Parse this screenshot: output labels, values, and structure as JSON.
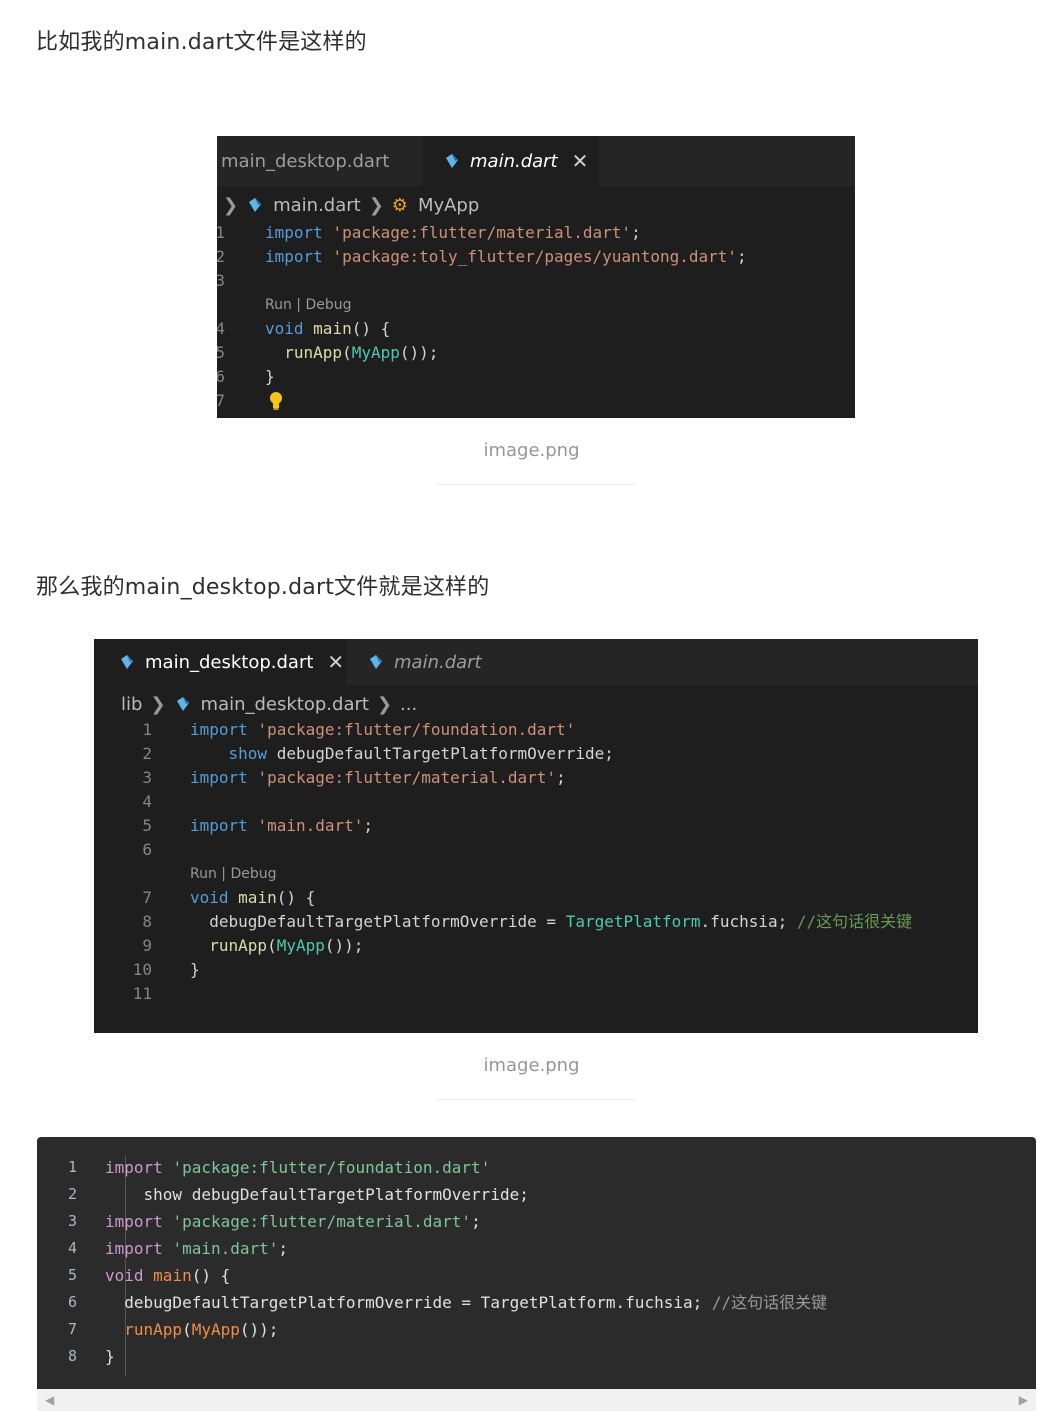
{
  "intro1": "比如我的main.dart文件是这样的",
  "intro2": "那么我的main_desktop.dart文件就是这样的",
  "caption": "image.png",
  "shot1": {
    "tab_inactive": "main_desktop.dart",
    "tab_active": "main.dart",
    "crumb_file": "main.dart",
    "crumb_class": "MyApp",
    "lines": [
      {
        "n": "1",
        "segments": [
          [
            "kw",
            "import"
          ],
          [
            "plain",
            " "
          ],
          [
            "str",
            "'package:flutter/material.dart'"
          ],
          [
            "plain",
            ";"
          ]
        ]
      },
      {
        "n": "2",
        "segments": [
          [
            "kw",
            "import"
          ],
          [
            "plain",
            " "
          ],
          [
            "str",
            "'package:toly_flutter/pages/yuantong.dart'"
          ],
          [
            "plain",
            ";"
          ]
        ]
      },
      {
        "n": "3",
        "segments": []
      },
      {
        "lens": "Run | Debug"
      },
      {
        "n": "4",
        "segments": [
          [
            "kw",
            "void"
          ],
          [
            "plain",
            " "
          ],
          [
            "fn",
            "main"
          ],
          [
            "plain",
            "() {"
          ]
        ]
      },
      {
        "n": "5",
        "segments": [
          [
            "plain",
            "  "
          ],
          [
            "fn",
            "runApp"
          ],
          [
            "plain",
            "("
          ],
          [
            "cls",
            "MyApp"
          ],
          [
            "plain",
            "());"
          ]
        ]
      },
      {
        "n": "6",
        "segments": [
          [
            "plain",
            "}"
          ]
        ]
      },
      {
        "n": "7",
        "segments": []
      }
    ]
  },
  "shot2": {
    "tab_active": "main_desktop.dart",
    "tab_inactive": "main.dart",
    "crumb_lib": "lib",
    "crumb_file": "main_desktop.dart",
    "crumb_more": "...",
    "lines": [
      {
        "n": "1",
        "segments": [
          [
            "kw",
            "import"
          ],
          [
            "plain",
            " "
          ],
          [
            "str",
            "'package:flutter/foundation.dart'"
          ]
        ]
      },
      {
        "n": "2",
        "segments": [
          [
            "plain",
            "    "
          ],
          [
            "kw",
            "show"
          ],
          [
            "plain",
            " debugDefaultTargetPlatformOverride;"
          ]
        ]
      },
      {
        "n": "3",
        "segments": [
          [
            "kw",
            "import"
          ],
          [
            "plain",
            " "
          ],
          [
            "str",
            "'package:flutter/material.dart'"
          ],
          [
            "plain",
            ";"
          ]
        ]
      },
      {
        "n": "4",
        "segments": []
      },
      {
        "n": "5",
        "segments": [
          [
            "kw",
            "import"
          ],
          [
            "plain",
            " "
          ],
          [
            "str",
            "'main.dart'"
          ],
          [
            "plain",
            ";"
          ]
        ]
      },
      {
        "n": "6",
        "segments": []
      },
      {
        "lens": "Run | Debug"
      },
      {
        "n": "7",
        "segments": [
          [
            "kw",
            "void"
          ],
          [
            "plain",
            " "
          ],
          [
            "fn",
            "main"
          ],
          [
            "plain",
            "() {"
          ]
        ]
      },
      {
        "n": "8",
        "segments": [
          [
            "plain",
            "  debugDefaultTargetPlatformOverride = "
          ],
          [
            "cls",
            "TargetPlatform"
          ],
          [
            "plain",
            ".fuchsia; "
          ],
          [
            "cmt",
            "//这句话很关键"
          ]
        ]
      },
      {
        "n": "9",
        "segments": [
          [
            "plain",
            "  "
          ],
          [
            "fn",
            "runApp"
          ],
          [
            "plain",
            "("
          ],
          [
            "cls",
            "MyApp"
          ],
          [
            "plain",
            "());"
          ]
        ]
      },
      {
        "n": "10",
        "segments": [
          [
            "plain",
            "}"
          ]
        ]
      },
      {
        "n": "11",
        "segments": []
      }
    ]
  },
  "codeblock": {
    "lines": [
      {
        "n": "1",
        "segments": [
          [
            "hkw2",
            "import"
          ],
          [
            "hplain",
            " "
          ],
          [
            "hstr",
            "'package:flutter/foundation.dart'"
          ]
        ]
      },
      {
        "n": "2",
        "segments": [
          [
            "hplain",
            "    show debugDefaultTargetPlatformOverride;"
          ]
        ]
      },
      {
        "n": "3",
        "segments": [
          [
            "hkw2",
            "import"
          ],
          [
            "hplain",
            " "
          ],
          [
            "hstr",
            "'package:flutter/material.dart'"
          ],
          [
            "hplain",
            ";"
          ]
        ]
      },
      {
        "n": "4",
        "segments": [
          [
            "hkw2",
            "import"
          ],
          [
            "hplain",
            " "
          ],
          [
            "hstr",
            "'main.dart'"
          ],
          [
            "hplain",
            ";"
          ]
        ]
      },
      {
        "n": "5",
        "segments": [
          [
            "hkw2",
            "void"
          ],
          [
            "hplain",
            " "
          ],
          [
            "hfunc",
            "main"
          ],
          [
            "hplain",
            "() {"
          ]
        ]
      },
      {
        "n": "6",
        "segments": [
          [
            "hplain",
            "  debugDefaultTargetPlatformOverride = TargetPlatform.fuchsia; "
          ],
          [
            "hc",
            "//这句话很关键"
          ]
        ]
      },
      {
        "n": "7",
        "segments": [
          [
            "hplain",
            "  "
          ],
          [
            "hfunc",
            "runApp"
          ],
          [
            "hplain",
            "("
          ],
          [
            "hfunc",
            "MyApp"
          ],
          [
            "hplain",
            "());"
          ]
        ]
      },
      {
        "n": "8",
        "segments": [
          [
            "hplain",
            "}"
          ]
        ]
      }
    ]
  },
  "icons": {
    "dart": "dart-icon",
    "close": "close-icon",
    "chevron": "chevron-right-icon",
    "class": "class-symbol-icon",
    "bulb": "lightbulb-icon"
  }
}
